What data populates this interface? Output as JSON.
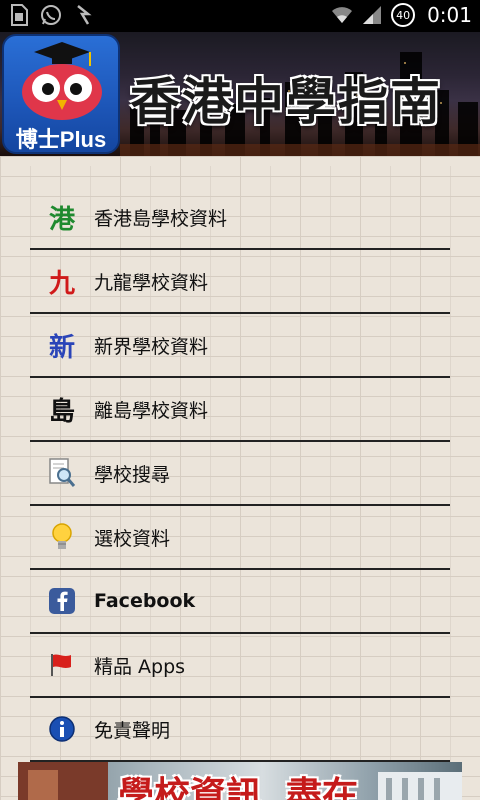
{
  "status_bar": {
    "time": "0:01",
    "battery": "40",
    "icons": [
      "sim-icon",
      "whatsapp-icon",
      "sync-icon",
      "wifi-icon",
      "signal-icon"
    ]
  },
  "header": {
    "title": "香港中學指南",
    "logo_text": "博士Plus"
  },
  "menu": {
    "items": [
      {
        "icon_glyph": "港",
        "icon_color": "#1f8a2f",
        "label": "香港島學校資料"
      },
      {
        "icon_glyph": "九",
        "icon_color": "#d01a1a",
        "label": "九龍學校資料"
      },
      {
        "icon_glyph": "新",
        "icon_color": "#2a44b8",
        "label": "新界學校資料"
      },
      {
        "icon_glyph": "島",
        "icon_color": "#111111",
        "label": "離島學校資料"
      },
      {
        "icon": "search-icon",
        "label": "學校搜尋"
      },
      {
        "icon": "lightbulb-icon",
        "label": "選校資料"
      },
      {
        "icon": "facebook-icon",
        "label": "Facebook"
      },
      {
        "icon": "flag-icon",
        "label": "精品 Apps"
      },
      {
        "icon": "info-icon",
        "label": "免責聲明"
      }
    ]
  },
  "ad_banner": {
    "text1": "學校資訊",
    "text2": "盡在"
  },
  "colors": {
    "background": "#ebe4da",
    "divider": "#222222",
    "logo_blue": "#1d56b8"
  }
}
